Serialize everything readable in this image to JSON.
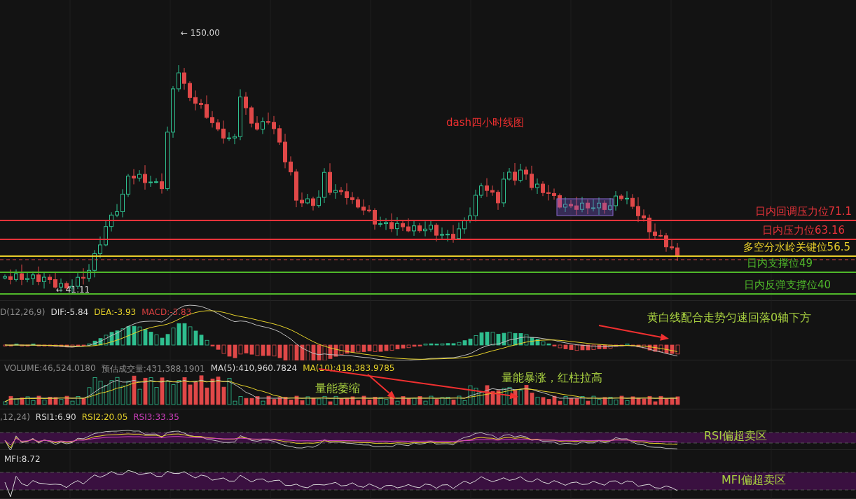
{
  "main_chart": {
    "title": "dash四小时线图",
    "high_marker": "← 150.00",
    "low_marker": "← 41.11",
    "levels": [
      {
        "label": "日内回调压力位71.1",
        "color": "#e8333a"
      },
      {
        "label": "日内压力位63.16",
        "color": "#e8333a"
      },
      {
        "label": "多空分水岭关键位56.5",
        "color": "#e8cf2a"
      },
      {
        "label": "日内支撑位49",
        "color": "#4fb82a"
      },
      {
        "label": "日内反弹支撑位40",
        "color": "#4fb82a"
      }
    ]
  },
  "macd": {
    "header": [
      {
        "text": "D(12,26,9)",
        "color": "#8c8c8c"
      },
      {
        "text": "DIF:-5.84",
        "color": "#d8d8d8"
      },
      {
        "text": "DEA:-3.93",
        "color": "#e6d22a"
      },
      {
        "text": "MACD:-3.83",
        "color": "#d84040"
      }
    ],
    "annotations": [
      "黄白线配合走势匀速回落0轴下方"
    ]
  },
  "volume": {
    "header": [
      {
        "text": "VOLUME:46,524.0180",
        "color": "#8c8c8c"
      },
      {
        "text": "预估成交量:431,388.1901",
        "color": "#8c8c8c"
      },
      {
        "text": "MA(5):410,960.7824",
        "color": "#d8d8d8"
      },
      {
        "text": "MA(10):418,383.9785",
        "color": "#e6d22a"
      }
    ],
    "annotations": [
      "量能萎缩",
      "量能暴涨，红柱拉高"
    ]
  },
  "rsi": {
    "header": [
      {
        "text": ",12,24)",
        "color": "#8c8c8c"
      },
      {
        "text": "RSI1:6.90",
        "color": "#d8d8d8"
      },
      {
        "text": "RSI2:20.05",
        "color": "#e6d22a"
      },
      {
        "text": "RSI3:33.35",
        "color": "#d040c0"
      }
    ],
    "annotations": [
      "RSI偏超卖区"
    ]
  },
  "mfi": {
    "header": [
      {
        "text": "MFI:8.72",
        "color": "#d8d8d8"
      }
    ],
    "annotations": [
      "MFI偏超卖区"
    ]
  }
}
